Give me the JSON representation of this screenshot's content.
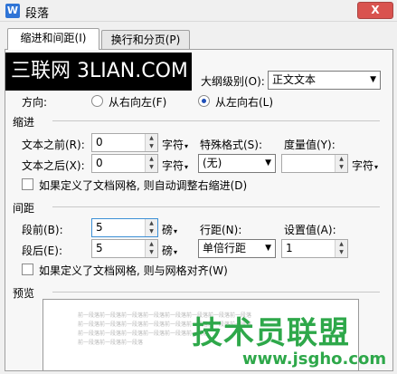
{
  "window": {
    "title": "段落",
    "app_icon": "W",
    "close_glyph": "X"
  },
  "tabs": [
    {
      "label": "缩进和间距(I)",
      "active": true
    },
    {
      "label": "换行和分页(P)",
      "active": false
    }
  ],
  "watermark_top": "三联网 3LIAN.COM",
  "general": {
    "outline_label": "大纲级别(O):",
    "outline_value": "正文文本",
    "direction_label": "方向:",
    "rtl_label": "从右向左(F)",
    "ltr_label": "从左向右(L)",
    "ltr_checked": true
  },
  "indent": {
    "title": "缩进",
    "before_label": "文本之前(R):",
    "before_value": "0",
    "before_unit": "字符",
    "after_label": "文本之后(X):",
    "after_value": "0",
    "after_unit": "字符",
    "special_label": "特殊格式(S):",
    "special_value": "(无)",
    "measure_label": "度量值(Y):",
    "measure_value": "",
    "measure_unit": "字符",
    "auto_adjust_label": "如果定义了文档网格, 则自动调整右缩进(D)"
  },
  "spacing": {
    "title": "间距",
    "before_label": "段前(B):",
    "before_value": "5",
    "before_unit": "磅",
    "after_label": "段后(E):",
    "after_value": "5",
    "after_unit": "磅",
    "line_label": "行距(N):",
    "line_value": "单倍行距",
    "setting_label": "设置值(A):",
    "setting_value": "1",
    "snap_grid_label": "如果定义了文档网格, 则与网格对齐(W)"
  },
  "preview": {
    "title": "预览",
    "lines": [
      "前一段落前一段落前一段落前一段落前一段落前一段落前一段落前一段落",
      "前一段落前一段落前一段落前一段落前一段落前一段落前一段落前一段落",
      "前一段落前一段落前一段落前一段落前一段落前一段落",
      "前一段落前一段落前一段落"
    ]
  },
  "watermark_bottom": {
    "logo": "技术员联盟",
    "url": "www.jsgho.com"
  }
}
